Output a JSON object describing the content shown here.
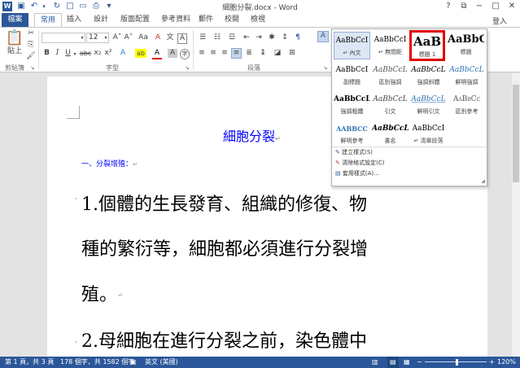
{
  "window": {
    "title": "細胞分裂.docx - Word",
    "help": "?",
    "user": "登入"
  },
  "tabs": [
    {
      "label": "檔案"
    },
    {
      "label": "常用"
    },
    {
      "label": "插入"
    },
    {
      "label": "設計"
    },
    {
      "label": "版面配置"
    },
    {
      "label": "參考資料"
    },
    {
      "label": "郵件"
    },
    {
      "label": "校閱"
    },
    {
      "label": "檢視"
    }
  ],
  "ribbon": {
    "clipboard": {
      "paste": "貼上",
      "label": "剪貼簿"
    },
    "font": {
      "label": "字型",
      "font_name": "",
      "font_size": "12",
      "grow": "A˄",
      "shrink": "A˅",
      "case": "Aa",
      "clear": "A",
      "bold": "B",
      "italic": "I",
      "underline": "U",
      "strike": "abc",
      "sub": "x₂",
      "sup": "x²",
      "effects": "A",
      "highlight": "ab",
      "color": "A",
      "shade": "A"
    },
    "paragraph": {
      "label": "段落"
    },
    "styles_peek": {
      "label": "A"
    }
  },
  "gallery": {
    "styles": [
      {
        "preview": "AaBbCcI",
        "name": "↵ 內文"
      },
      {
        "preview": "AaBbCcI",
        "name": "↵ 無間距"
      },
      {
        "preview": "AaB",
        "name": "標題 1"
      },
      {
        "preview": "AaBbC",
        "name": "標題"
      },
      {
        "preview": "AaBbCcI",
        "name": "副標題"
      },
      {
        "preview": "AaBbCcL",
        "name": "區別強調"
      },
      {
        "preview": "AaBbCcL",
        "name": "強調斜體"
      },
      {
        "preview": "AaBbCcL",
        "name": "鮮明強調"
      },
      {
        "preview": "AaBbCcL",
        "name": "強調粗體"
      },
      {
        "preview": "AaBbCcL",
        "name": "引文"
      },
      {
        "preview": "AaBbCcL",
        "name": "鮮明引文"
      },
      {
        "preview": "AaBbCc",
        "name": "區別參考"
      },
      {
        "preview": "AABBCC",
        "name": "鮮明參考"
      },
      {
        "preview": "AaBbCcL",
        "name": "書名"
      },
      {
        "preview": "AaBbCcI",
        "name": "↵ 清單段落"
      }
    ],
    "commands": [
      {
        "label": "建立樣式(S)"
      },
      {
        "label": "清除格式設定(C)"
      },
      {
        "label": "套用樣式(A)..."
      }
    ]
  },
  "document": {
    "title": "細胞分裂",
    "heading": "一、分裂增殖：",
    "para1": [
      "1.個體的生長發育、組織的修復、物",
      "種的繁衍等，細胞都必須進行分裂增",
      "殖。"
    ],
    "para2": "2.母細胞在進行分裂之前，染色體中",
    "mark": "↵"
  },
  "status": {
    "page": "第 1 頁，共 3 頁",
    "words": "178 個字，共 1582 個字",
    "language": "英文 (美國)",
    "zoom": "120%",
    "minus": "−",
    "plus": "+"
  }
}
